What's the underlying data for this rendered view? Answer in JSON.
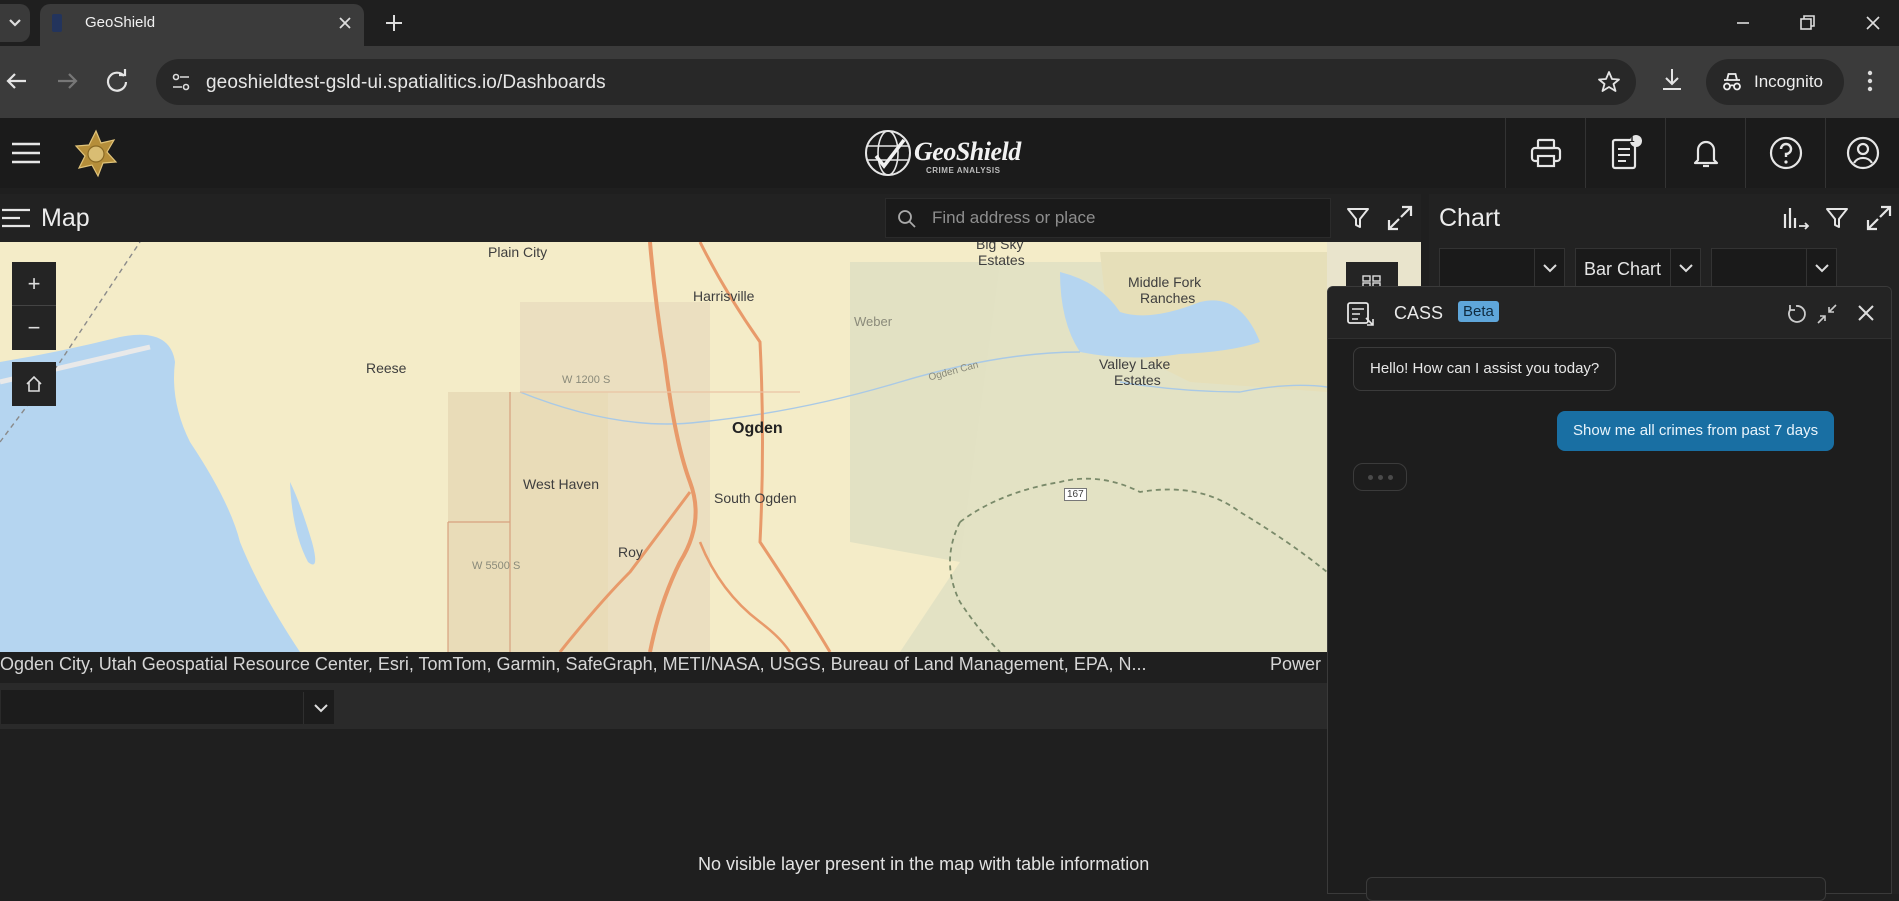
{
  "browser": {
    "tab_title": "GeoShield",
    "url": "geoshieldtest-gsld-ui.spatialitics.io/Dashboards",
    "incognito_label": "Incognito"
  },
  "app": {
    "brand_name": "GeoShield",
    "brand_subtitle": "CRIME ANALYSIS",
    "notifications_count": "1"
  },
  "map_panel": {
    "title": "Map",
    "search_placeholder": "Find address or place",
    "zoom_in": "+",
    "zoom_out": "−",
    "labels": {
      "plain_city": "Plain City",
      "big_sky": "Big Sky",
      "estates": "Estates",
      "middle_fork": "Middle Fork",
      "ranches": "Ranches",
      "harrisville": "Harrisville",
      "weber": "Weber",
      "reese": "Reese",
      "w1200": "W 1200 S",
      "ogden_can": "Ogden Can",
      "valley_lake": "Valley Lake",
      "valley_estates": "Estates",
      "ogden": "Ogden",
      "west_haven": "West Haven",
      "south_ogden": "South Ogden",
      "hwy167": "167",
      "roy": "Roy",
      "w5500": "W 5500 S"
    },
    "attribution": "Ogden City, Utah Geospatial Resource Center, Esri, TomTom, Garmin, SafeGraph, METI/NASA, USGS, Bureau of Land Management, EPA, N...",
    "powered_by": "Power"
  },
  "table_panel": {
    "selected_layer": "",
    "empty_message": "No visible layer present in the map with table information"
  },
  "chart_panel": {
    "title": "Chart",
    "chart_type": "Bar Chart"
  },
  "cass": {
    "title": "CASS",
    "badge": "Beta",
    "messages": [
      {
        "role": "bot",
        "text": "Hello! How can I assist you today?"
      },
      {
        "role": "user",
        "text": "Show me all crimes from past 7 days"
      }
    ]
  },
  "colors": {
    "accent_blue": "#196fa3",
    "beta_badge": "#5fa6da",
    "map_land": "#f4ecc8",
    "map_water": "#b5d5f0",
    "map_road": "#e89a6a"
  }
}
